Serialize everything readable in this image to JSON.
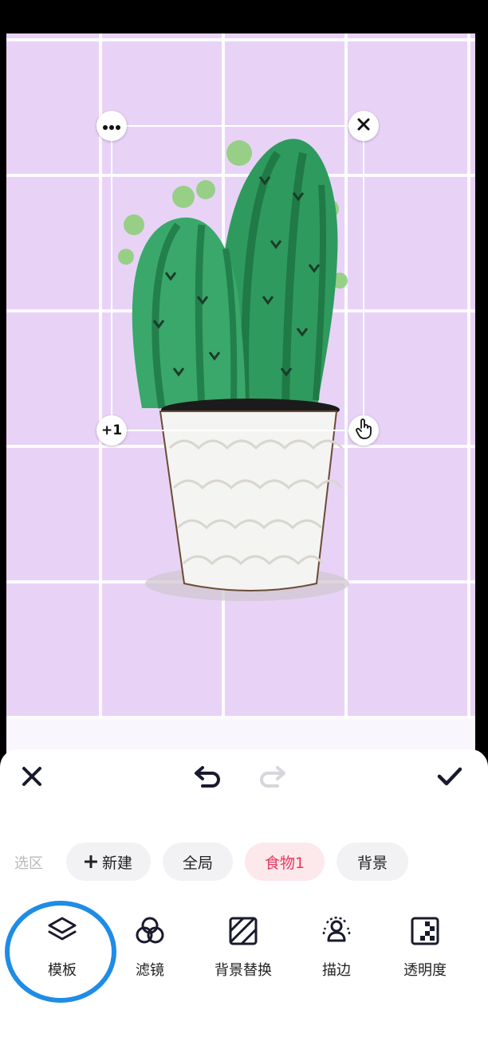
{
  "canvas": {
    "background": "#e8d3f7",
    "sticker_handles": {
      "top_left_icon": "more-dots-icon",
      "top_right_icon": "close-icon",
      "bottom_left_label": "+1",
      "bottom_right_icon": "hand-pointer-icon"
    }
  },
  "toolbar": {
    "close_icon": "close-icon",
    "undo_icon": "undo-icon",
    "redo_icon": "redo-icon",
    "confirm_icon": "checkmark-icon"
  },
  "selection": {
    "label": "选区",
    "new_label": "新建",
    "chips": [
      {
        "label": "全局",
        "active": false
      },
      {
        "label": "食物1",
        "active": true
      },
      {
        "label": "背景",
        "active": false
      }
    ]
  },
  "tools": [
    {
      "label": "模板",
      "icon": "layers-icon"
    },
    {
      "label": "滤镜",
      "icon": "filter-circles-icon"
    },
    {
      "label": "背景替换",
      "icon": "background-replace-icon"
    },
    {
      "label": "描边",
      "icon": "outline-person-icon"
    },
    {
      "label": "透明度",
      "icon": "opacity-icon"
    }
  ],
  "colors": {
    "accent": "#e8395e",
    "highlight": "#1f8ce6",
    "cactus": "#2e9a5c",
    "pot": "#f4f4f2"
  }
}
